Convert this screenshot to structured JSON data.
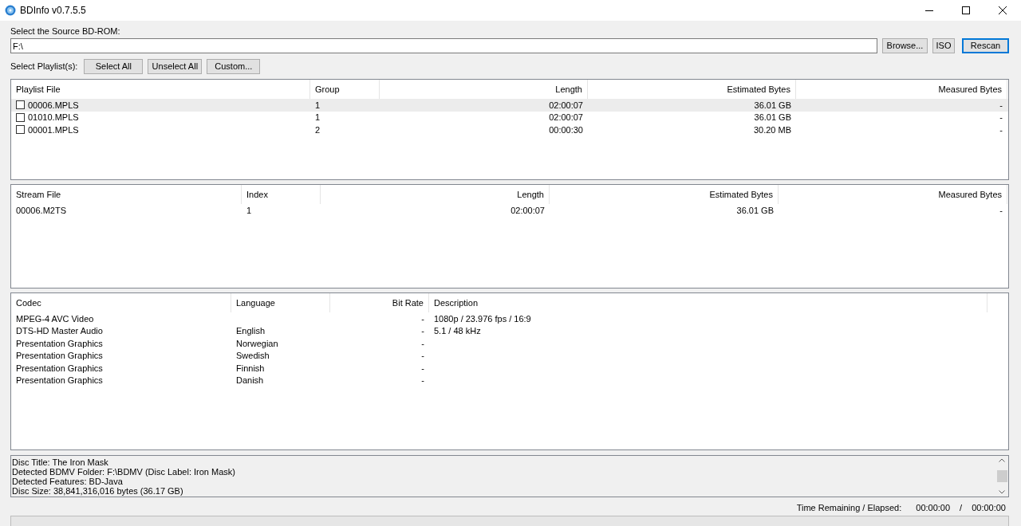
{
  "window": {
    "title": "BDInfo v0.7.5.5"
  },
  "source": {
    "label": "Select the Source BD-ROM:",
    "value": "F:\\",
    "buttons": [
      {
        "label": "Browse...",
        "default": false
      },
      {
        "label": "ISO",
        "default": false
      },
      {
        "label": "Rescan",
        "default": true
      }
    ]
  },
  "playlist_toolbar": {
    "label": "Select Playlist(s):",
    "buttons": [
      "Select All",
      "Unselect All",
      "Custom..."
    ]
  },
  "playlists": {
    "columns": [
      "Playlist File",
      "Group",
      "Length",
      "Estimated Bytes",
      "Measured Bytes"
    ],
    "rows": [
      {
        "selected": true,
        "checked": false,
        "cells": [
          "00006.MPLS",
          "1",
          "02:00:07",
          "36.01 GB",
          "-"
        ]
      },
      {
        "selected": false,
        "checked": false,
        "cells": [
          "01010.MPLS",
          "1",
          "02:00:07",
          "36.01 GB",
          "-"
        ]
      },
      {
        "selected": false,
        "checked": false,
        "cells": [
          "00001.MPLS",
          "2",
          "00:00:30",
          "30.20 MB",
          "-"
        ]
      }
    ]
  },
  "streams": {
    "columns": [
      "Stream File",
      "Index",
      "Length",
      "Estimated Bytes",
      "Measured Bytes"
    ],
    "rows": [
      {
        "cells": [
          "00006.M2TS",
          "1",
          "02:00:07",
          "36.01 GB",
          "-"
        ]
      }
    ]
  },
  "codecs": {
    "columns": [
      "Codec",
      "Language",
      "Bit Rate",
      "Description"
    ],
    "rows": [
      {
        "cells": [
          "MPEG-4 AVC Video",
          "",
          "-",
          "1080p / 23.976 fps / 16:9"
        ]
      },
      {
        "cells": [
          "DTS-HD Master Audio",
          "English",
          "-",
          "5.1 / 48 kHz"
        ]
      },
      {
        "cells": [
          "Presentation Graphics",
          "Norwegian",
          "-",
          ""
        ]
      },
      {
        "cells": [
          "Presentation Graphics",
          "Swedish",
          "-",
          ""
        ]
      },
      {
        "cells": [
          "Presentation Graphics",
          "Finnish",
          "-",
          ""
        ]
      },
      {
        "cells": [
          "Presentation Graphics",
          "Danish",
          "-",
          ""
        ]
      }
    ]
  },
  "info": [
    "Disc Title: The Iron Mask",
    "Detected BDMV Folder: F:\\BDMV (Disc Label: Iron Mask)",
    "Detected Features: BD-Java",
    "Disc Size: 38,841,316,016 bytes (36.17 GB)"
  ],
  "status": {
    "label": "Time Remaining / Elapsed:",
    "remaining": "00:00:00",
    "separator": "/",
    "elapsed": "00:00:00"
  },
  "progress": {
    "level": 0
  }
}
